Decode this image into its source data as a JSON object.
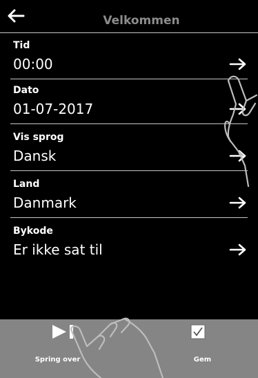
{
  "header": {
    "title": "Velkommen",
    "back_icon": "arrow-left-icon"
  },
  "rows": [
    {
      "label": "Tid",
      "value": "00:00"
    },
    {
      "label": "Dato",
      "value": "01-07-2017"
    },
    {
      "label": "Vis sprog",
      "value": "Dansk"
    },
    {
      "label": "Land",
      "value": "Danmark"
    },
    {
      "label": "Bykode",
      "value": "Er ikke sat til"
    }
  ],
  "bottom_bar": {
    "skip_label": "Spring over",
    "skip_icon": "skip-icon",
    "save_label": "Gem",
    "save_icon": "checkbox-checked-icon"
  }
}
